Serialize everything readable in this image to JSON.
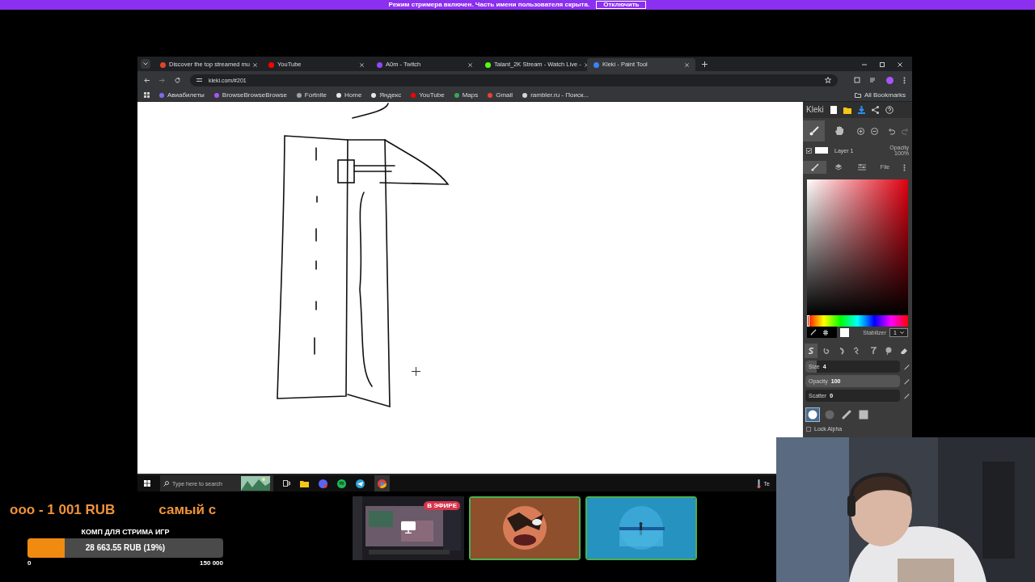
{
  "stream_banner": {
    "text": "Режим стримера включен. Часть имени пользователя скрыта.",
    "button": "Отключить"
  },
  "browser": {
    "tabs": [
      {
        "title": "Discover the top streamed mu",
        "selected": false,
        "color": "#e0452b"
      },
      {
        "title": "YouTube",
        "selected": false,
        "color": "#ff0000"
      },
      {
        "title": "A0m - Twitch",
        "selected": false,
        "color": "#9146ff"
      },
      {
        "title": "Talant_2K Stream - Watch Live -",
        "selected": false,
        "color": "#53fc18"
      },
      {
        "title": "Kleki - Paint Tool",
        "selected": true,
        "color": "#3b82f6"
      }
    ],
    "url": "kleki.com/#201",
    "bookmarks": [
      {
        "label": "Авиабилеты",
        "color": "#7c6cf0"
      },
      {
        "label": "BrowseBrowseBrowse",
        "color": "#a855f7"
      },
      {
        "label": "Fortnite",
        "color": "#9ca3af"
      },
      {
        "label": "Home",
        "color": "#e5e7eb"
      },
      {
        "label": "Яндекс",
        "color": "#e5e7eb"
      },
      {
        "label": "YouTube",
        "color": "#ff0000"
      },
      {
        "label": "Maps",
        "color": "#34a853"
      },
      {
        "label": "Gmail",
        "color": "#ea4335"
      },
      {
        "label": "rambler.ru - Поиск...",
        "color": "#d1d5db"
      }
    ],
    "all_bookmarks": "All Bookmarks"
  },
  "kleki": {
    "logo": "Kleki",
    "layer": {
      "name": "Layer 1",
      "visible": true,
      "opacity_label": "Opacity",
      "opacity": "100%"
    },
    "hue": {
      "level": 0
    },
    "tabs": [
      {
        "kind": "brush",
        "selected": true
      },
      {
        "kind": "layers",
        "selected": false
      },
      {
        "kind": "adjust",
        "selected": false
      },
      {
        "kind": "file",
        "label": "File",
        "selected": false
      }
    ],
    "stabilizer": {
      "label": "Stabilizer",
      "value": "1"
    },
    "brushes": [
      {
        "kind": "pen",
        "selected": true
      },
      {
        "kind": "blend",
        "selected": false
      },
      {
        "kind": "sketch",
        "selected": false
      },
      {
        "kind": "pixel",
        "selected": false
      },
      {
        "kind": "chemy",
        "selected": false
      },
      {
        "kind": "smudge",
        "selected": false
      },
      {
        "kind": "eraser",
        "selected": false
      }
    ],
    "sliders": [
      {
        "label": "Size",
        "value": "4",
        "level": 0.12
      },
      {
        "label": "Opacity",
        "value": "100",
        "level": 1
      },
      {
        "label": "Scatter",
        "value": "0",
        "level": 0
      }
    ],
    "tips": [
      {
        "kind": "round",
        "selected": true
      },
      {
        "kind": "soft",
        "selected": false
      },
      {
        "kind": "line",
        "selected": false
      },
      {
        "kind": "square",
        "selected": false
      }
    ],
    "lock_alpha": {
      "label": "Lock Alpha",
      "checked": false
    }
  },
  "taskbar": {
    "search_placeholder": "Type here to search",
    "tray_text": "Te"
  },
  "overlay": {
    "ticker": [
      "ooo - 1 001 RUB",
      "самый с"
    ],
    "goal": {
      "title": "КОМП ДЛЯ СТРИМА ИГР",
      "level": 0.19,
      "reading": "28 663.55 RUB (19%)",
      "min": "0",
      "max": "150 000"
    },
    "live_badge": "В ЭФИРЕ"
  }
}
